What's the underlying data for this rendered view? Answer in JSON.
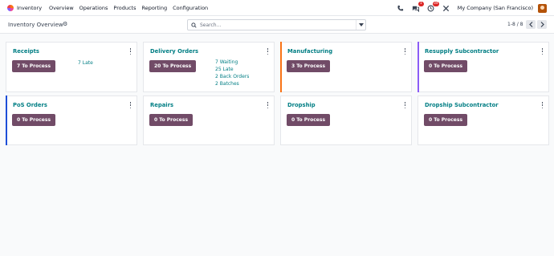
{
  "nav": {
    "brand": "Inventory",
    "items": [
      "Overview",
      "Operations",
      "Products",
      "Reporting",
      "Configuration"
    ]
  },
  "systray": {
    "chat_badge": "1",
    "activity_badge": "34",
    "company": "My Company (San Francisco)"
  },
  "control": {
    "title": "Inventory Overview",
    "search_placeholder": "Search...",
    "pager": "1-8 / 8"
  },
  "colors": {
    "primary": "#714b67",
    "link": "#017e84",
    "manufacturing_accent": "#f97316",
    "subcontractor_accent": "#8b5cf6",
    "pos_accent": "#1d4ed8"
  },
  "cards": [
    {
      "title": "Receipts",
      "button": "7 To Process",
      "stats": [
        "7 Late"
      ]
    },
    {
      "title": "Delivery Orders",
      "button": "20 To Process",
      "stats": [
        "7 Waiting",
        "25 Late",
        "2 Back Orders",
        "2 Batches"
      ]
    },
    {
      "title": "Manufacturing",
      "button": "3 To Process",
      "stats": []
    },
    {
      "title": "Resupply Subcontractor",
      "button": "0 To Process",
      "stats": []
    },
    {
      "title": "PoS Orders",
      "button": "0 To Process",
      "stats": []
    },
    {
      "title": "Repairs",
      "button": "0 To Process",
      "stats": []
    },
    {
      "title": "Dropship",
      "button": "0 To Process",
      "stats": []
    },
    {
      "title": "Dropship Subcontractor",
      "button": "0 To Process",
      "stats": []
    }
  ]
}
